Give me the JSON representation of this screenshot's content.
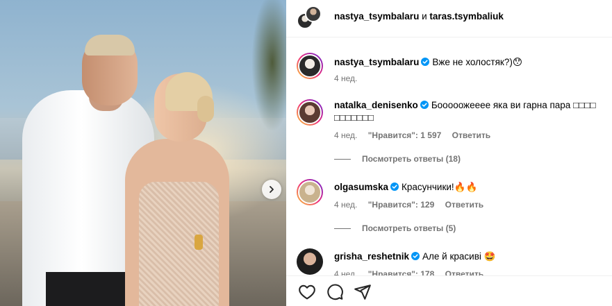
{
  "header": {
    "user1": "nastya_tsymbalaru",
    "conjunction": "и",
    "user2": "taras.tsymbaliuk"
  },
  "comments": [
    {
      "username": "nastya_tsymbalaru",
      "text": "Вже не холостяк?)",
      "emoji": "😯",
      "time": "4 нед."
    },
    {
      "username": "natalka_denisenko",
      "text": "Бооооожееее яка ви гарна пара ",
      "boxes_line1": "□□□□",
      "boxes_line2": "□□□□□□□",
      "time": "4 нед.",
      "likes": "\"Нравится\": 1 597",
      "reply": "Ответить",
      "view_replies": "Посмотреть ответы (18)"
    },
    {
      "username": "olgasumska",
      "text": "Красунчики!",
      "emoji": "🔥🔥",
      "time": "4 нед.",
      "likes": "\"Нравится\": 129",
      "reply": "Ответить",
      "view_replies": "Посмотреть ответы (5)"
    },
    {
      "username": "grisha_reshetnik",
      "text": "Але й красиві ",
      "emoji": "🤩",
      "time": "4 нед.",
      "likes": "\"Нравится\": 178",
      "reply": "Ответить"
    }
  ],
  "colors": {
    "verified": "#0095f6",
    "meta_text": "#737373",
    "divider": "#efefef"
  },
  "icons": [
    "chevron-right-icon",
    "heart-icon",
    "comment-icon",
    "share-icon",
    "verified-icon"
  ]
}
